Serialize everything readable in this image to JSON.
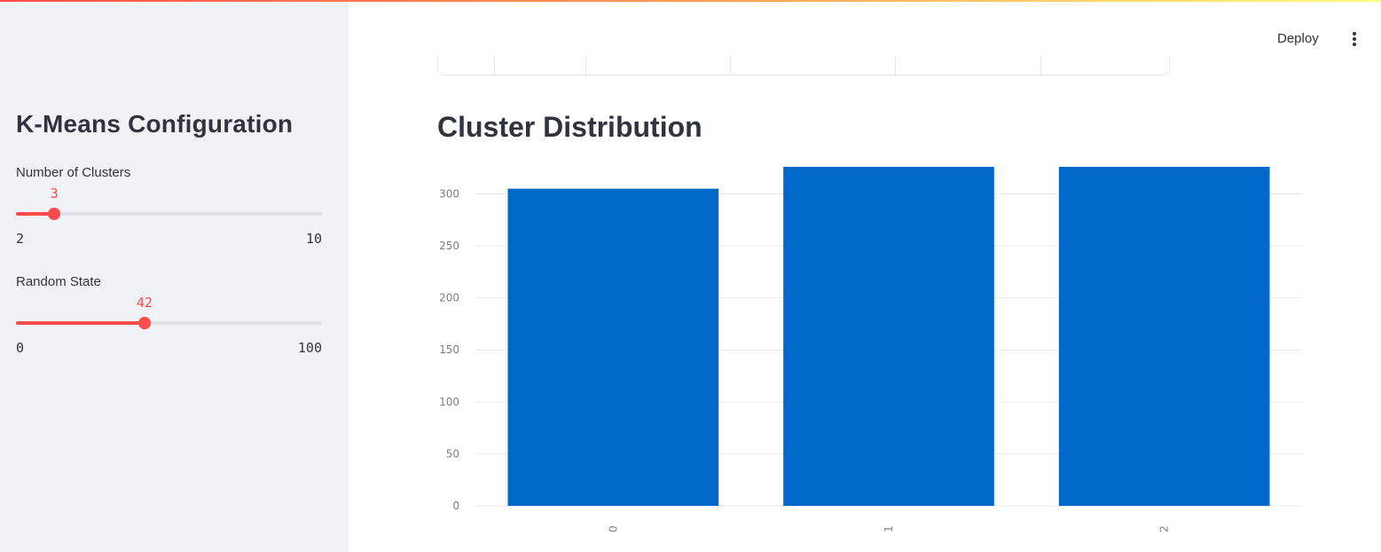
{
  "sidebar": {
    "title": "K-Means Configuration",
    "sliders": [
      {
        "label": "Number of Clusters",
        "value": "3",
        "min": "2",
        "max": "10",
        "fraction": 0.125
      },
      {
        "label": "Random State",
        "value": "42",
        "min": "0",
        "max": "100",
        "fraction": 0.42
      }
    ]
  },
  "toolbar": {
    "deploy_label": "Deploy",
    "menu_icon": "vertical-ellipsis-icon"
  },
  "main": {
    "section_title": "Cluster Distribution"
  },
  "colors": {
    "accent": "#ff4b4b",
    "bar": "#0068c9",
    "sidebar_bg": "#f0f2f6"
  },
  "chart_data": {
    "type": "bar",
    "categories": [
      "0",
      "1",
      "2"
    ],
    "values": [
      305,
      326,
      326
    ],
    "ylim": [
      0,
      326
    ],
    "yticks": [
      0,
      50,
      100,
      150,
      200,
      250,
      300
    ],
    "grid": true,
    "title": "",
    "xlabel": "",
    "ylabel": ""
  }
}
